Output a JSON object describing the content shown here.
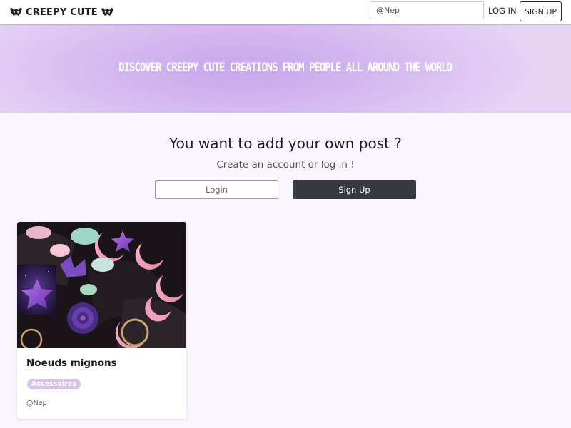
{
  "brand": {
    "name": "CREEPY CUTE",
    "icon": "bat-icon"
  },
  "navbar": {
    "search_value": "@Nep",
    "login_label": "LOG IN",
    "signup_label": "SIGN UP"
  },
  "hero": {
    "title": "DISCOVER CREEPY CUTE CREATIONS FROM PEOPLE ALL AROUND THE WORLD"
  },
  "cta": {
    "title": "You want to add your own post ?",
    "subtitle": "Create an account or log in !",
    "login_button": "Login",
    "signup_button": "Sign Up"
  },
  "posts": [
    {
      "title": "Noeuds mignons",
      "tag": "Accessoires",
      "author": "@Nep"
    }
  ],
  "colors": {
    "hero_accent": "#c8a6ec",
    "tag_bg": "#dcc0ec",
    "signup_bg": "#343a40",
    "page_bg": "#fbf5fd"
  }
}
